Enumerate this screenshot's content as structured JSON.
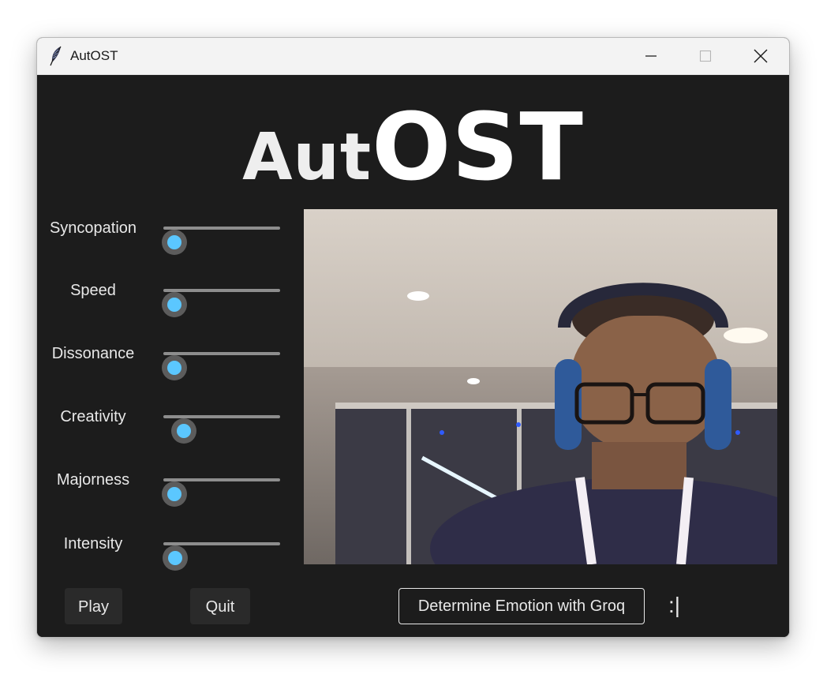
{
  "window": {
    "title": "AutOST",
    "icon": "feather-icon",
    "controls": [
      "minimize-icon",
      "maximize-icon",
      "close-icon"
    ]
  },
  "logo": {
    "part1": "Aut",
    "part2": "OST"
  },
  "sliders": [
    {
      "label": "Syncopation",
      "value": 0.0
    },
    {
      "label": "Speed",
      "value": 0.0
    },
    {
      "label": "Dissonance",
      "value": 0.0
    },
    {
      "label": "Creativity",
      "value": 0.1
    },
    {
      "label": "Majorness",
      "value": 0.0
    },
    {
      "label": "Intensity",
      "value": 0.01
    }
  ],
  "buttons": {
    "play": "Play",
    "quit": "Quit",
    "groq": "Determine Emotion with Groq"
  },
  "emotion_text": ":|",
  "colors": {
    "background": "#1c1c1c",
    "accent": "#5bc7ff",
    "track": "#8d8d8d",
    "text": "#e8e8e8"
  }
}
